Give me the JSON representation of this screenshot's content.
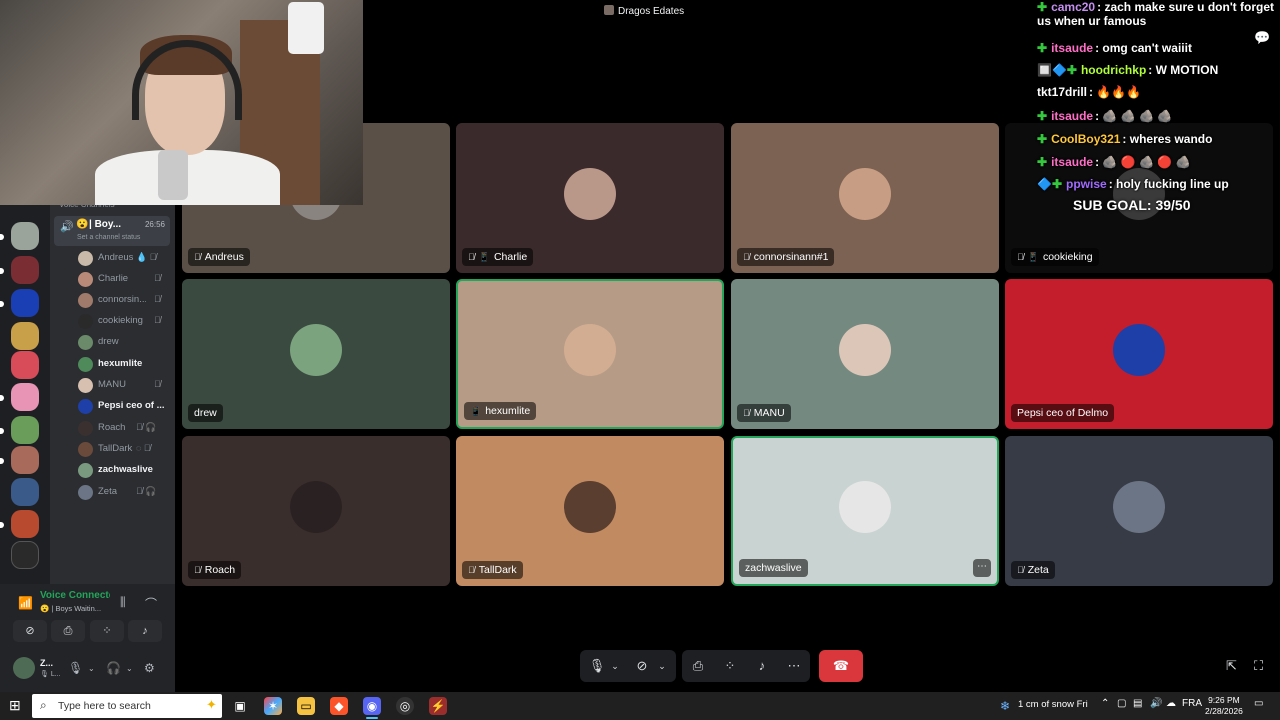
{
  "window": {
    "title": "Dragos Edates"
  },
  "sidebar": {
    "section_label": "Voice Channels",
    "channel": {
      "emoji": "😮",
      "name": "| Boy...",
      "time": "26:56",
      "status_placeholder": "Set a channel status"
    },
    "members": [
      {
        "name": "Andreus",
        "live": false,
        "icons": "💧 🎙̸"
      },
      {
        "name": "Charlie",
        "live": false,
        "icons": "🎙̸"
      },
      {
        "name": "connorsin...",
        "live": false,
        "icons": "🎙̸"
      },
      {
        "name": "cookieking",
        "live": false,
        "icons": "🎙̸"
      },
      {
        "name": "drew",
        "live": false,
        "icons": ""
      },
      {
        "name": "hexumlite",
        "live": true,
        "icons": ""
      },
      {
        "name": "MANU",
        "live": false,
        "icons": "🎙̸"
      },
      {
        "name": "Pepsi ceo of ...",
        "live": true,
        "icons": ""
      },
      {
        "name": "Roach",
        "live": false,
        "icons": "🎙̸ 🎧"
      },
      {
        "name": "TallDark",
        "live": false,
        "icons": "◌ 🎙̸"
      },
      {
        "name": "zachwaslive",
        "live": true,
        "icons": ""
      },
      {
        "name": "Zeta",
        "live": false,
        "icons": "🎙̸ 🎧"
      }
    ]
  },
  "voice_panel": {
    "title": "Voice Connecte",
    "subtitle": "😮 | Boys Waitin...",
    "user_name": "Z...",
    "user_sub": "🎙 L..."
  },
  "tiles": [
    {
      "name": "Andreus",
      "mic_icon": "🎙̸",
      "device_icon": "",
      "bg": "#5a5048",
      "avatar_color": "#8a8480",
      "speaking": false,
      "more": false
    },
    {
      "name": "Charlie",
      "mic_icon": "🎙̸",
      "device_icon": "📱",
      "bg": "#3b2a2c",
      "avatar_color": "#b9988a",
      "speaking": false,
      "more": false
    },
    {
      "name": "connorsinann#1",
      "mic_icon": "🎙̸",
      "device_icon": "",
      "bg": "#7c6253",
      "avatar_color": "#c79d83",
      "speaking": false,
      "more": false
    },
    {
      "name": "cookieking",
      "mic_icon": "🎙̸",
      "device_icon": "📱",
      "bg": "#0c0c0c",
      "avatar_color": "#3a3a3a",
      "speaking": false,
      "more": false
    },
    {
      "name": "drew",
      "mic_icon": "",
      "device_icon": "",
      "bg": "#3b4a40",
      "avatar_color": "#7aa37e",
      "speaking": false,
      "more": false
    },
    {
      "name": "hexumlite",
      "mic_icon": "",
      "device_icon": "📱",
      "bg": "#b69c86",
      "avatar_color": "#d2ad92",
      "speaking": true,
      "more": false
    },
    {
      "name": "MANU",
      "mic_icon": "🎙̸",
      "device_icon": "",
      "bg": "#748a80",
      "avatar_color": "#dcc6b8",
      "speaking": false,
      "more": false
    },
    {
      "name": "Pepsi ceo of Delmo",
      "mic_icon": "",
      "device_icon": "",
      "bg": "#c41d2c",
      "avatar_color": "#1e3fa8",
      "speaking": false,
      "more": false
    },
    {
      "name": "Roach",
      "mic_icon": "🎙̸",
      "device_icon": "",
      "bg": "#3a2e2d",
      "avatar_color": "#2a2222",
      "speaking": false,
      "more": false
    },
    {
      "name": "TallDark",
      "mic_icon": "🎙̸",
      "device_icon": "",
      "bg": "#c28a60",
      "avatar_color": "#5a3e30",
      "speaking": false,
      "more": false
    },
    {
      "name": "zachwaslive",
      "mic_icon": "",
      "device_icon": "",
      "bg": "#c9d3d1",
      "avatar_color": "#e6e6e6",
      "speaking": true,
      "more": true
    },
    {
      "name": "Zeta",
      "mic_icon": "🎙̸",
      "device_icon": "",
      "bg": "#363b45",
      "avatar_color": "#6c7585",
      "speaking": false,
      "more": false
    }
  ],
  "chat": [
    {
      "badge": "✚",
      "user": "camc20",
      "color": "#c58ff0",
      "text": ": zach make sure u don't forget",
      "line2": "us when ur famous"
    },
    {
      "badge": "✚",
      "user": "itsaude",
      "color": "#ff6ec7",
      "text": ": omg can't waiiit"
    },
    {
      "badge": "🔲🔷✚",
      "user": "hoodrichkp",
      "color": "#b0ff3a",
      "text": ": W MOTION"
    },
    {
      "badge": "",
      "user": "tkt17drill",
      "color": "#ffffff",
      "text": ": 🔥🔥🔥"
    },
    {
      "badge": "✚",
      "user": "itsaude",
      "color": "#ff6ec7",
      "text": ": 🪨 🪨 🪨 🪨"
    },
    {
      "badge": "✚",
      "user": "CoolBoy321",
      "color": "#ffc83d",
      "text": ": wheres wando"
    },
    {
      "badge": "✚",
      "user": "itsaude",
      "color": "#ff6ec7",
      "text": ": 🪨 🔴 🪨 🔴 🪨"
    },
    {
      "badge": "🔷✚",
      "user": "ppwise",
      "color": "#a06bff",
      "text": ": holy fucking line up"
    }
  ],
  "sub_goal": "SUB GOAL: 39/50",
  "taskbar": {
    "search_placeholder": "Type here to search",
    "weather": "1 cm of snow Fri",
    "lang": "FRA",
    "time": "9:26 PM",
    "date": "2/28/2026"
  }
}
